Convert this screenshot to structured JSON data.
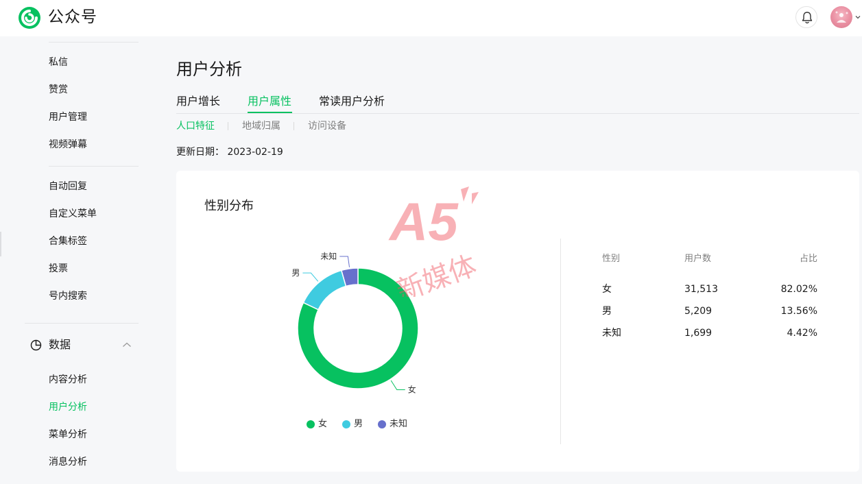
{
  "header": {
    "brand": "公众号",
    "brand_color": "#07c160",
    "icons": {
      "logo": "wechat-official-logo",
      "bell": "bell-icon",
      "avatar": "user-avatar",
      "caret": "chevron-down-icon"
    }
  },
  "sidebar": {
    "items_a": [
      {
        "label": "私信"
      },
      {
        "label": "赞赏"
      },
      {
        "label": "用户管理"
      },
      {
        "label": "视频弹幕"
      }
    ],
    "items_b": [
      {
        "label": "自动回复"
      },
      {
        "label": "自定义菜单"
      },
      {
        "label": "合集标签"
      },
      {
        "label": "投票"
      },
      {
        "label": "号内搜索"
      }
    ],
    "group": {
      "label": "数据",
      "icon": "pie-chart-icon",
      "expanded": true
    },
    "items_c": [
      {
        "label": "内容分析"
      },
      {
        "label": "用户分析",
        "active": true
      },
      {
        "label": "菜单分析"
      },
      {
        "label": "消息分析"
      }
    ]
  },
  "main": {
    "title": "用户分析",
    "tabs": [
      {
        "label": "用户增长"
      },
      {
        "label": "用户属性",
        "active": true
      },
      {
        "label": "常读用户分析"
      }
    ],
    "subtabs": [
      {
        "label": "人口特征",
        "active": true
      },
      {
        "label": "地域归属"
      },
      {
        "label": "访问设备"
      }
    ],
    "update_label": "更新日期：",
    "update_date": "2023-02-19"
  },
  "card": {
    "title": "性别分布",
    "table": {
      "headers": [
        "性别",
        "用户数",
        "占比"
      ],
      "rows": [
        [
          "女",
          "31,513",
          "82.02%"
        ],
        [
          "男",
          "5,209",
          "13.56%"
        ],
        [
          "未知",
          "1,699",
          "4.42%"
        ]
      ]
    }
  },
  "chart_data": {
    "type": "pie",
    "donut": true,
    "categories": [
      "女",
      "男",
      "未知"
    ],
    "values": [
      31513,
      5209,
      1699
    ],
    "percent": [
      82.02,
      13.56,
      4.42
    ],
    "colors": [
      "#07c160",
      "#3fcbe0",
      "#6770cc"
    ],
    "slice_labels": [
      "女",
      "男",
      "未知"
    ],
    "legend": [
      "女",
      "男",
      "未知"
    ],
    "legend_placement": "bottom"
  },
  "watermark": {
    "text": "新媒体",
    "logo_text": "A5"
  }
}
